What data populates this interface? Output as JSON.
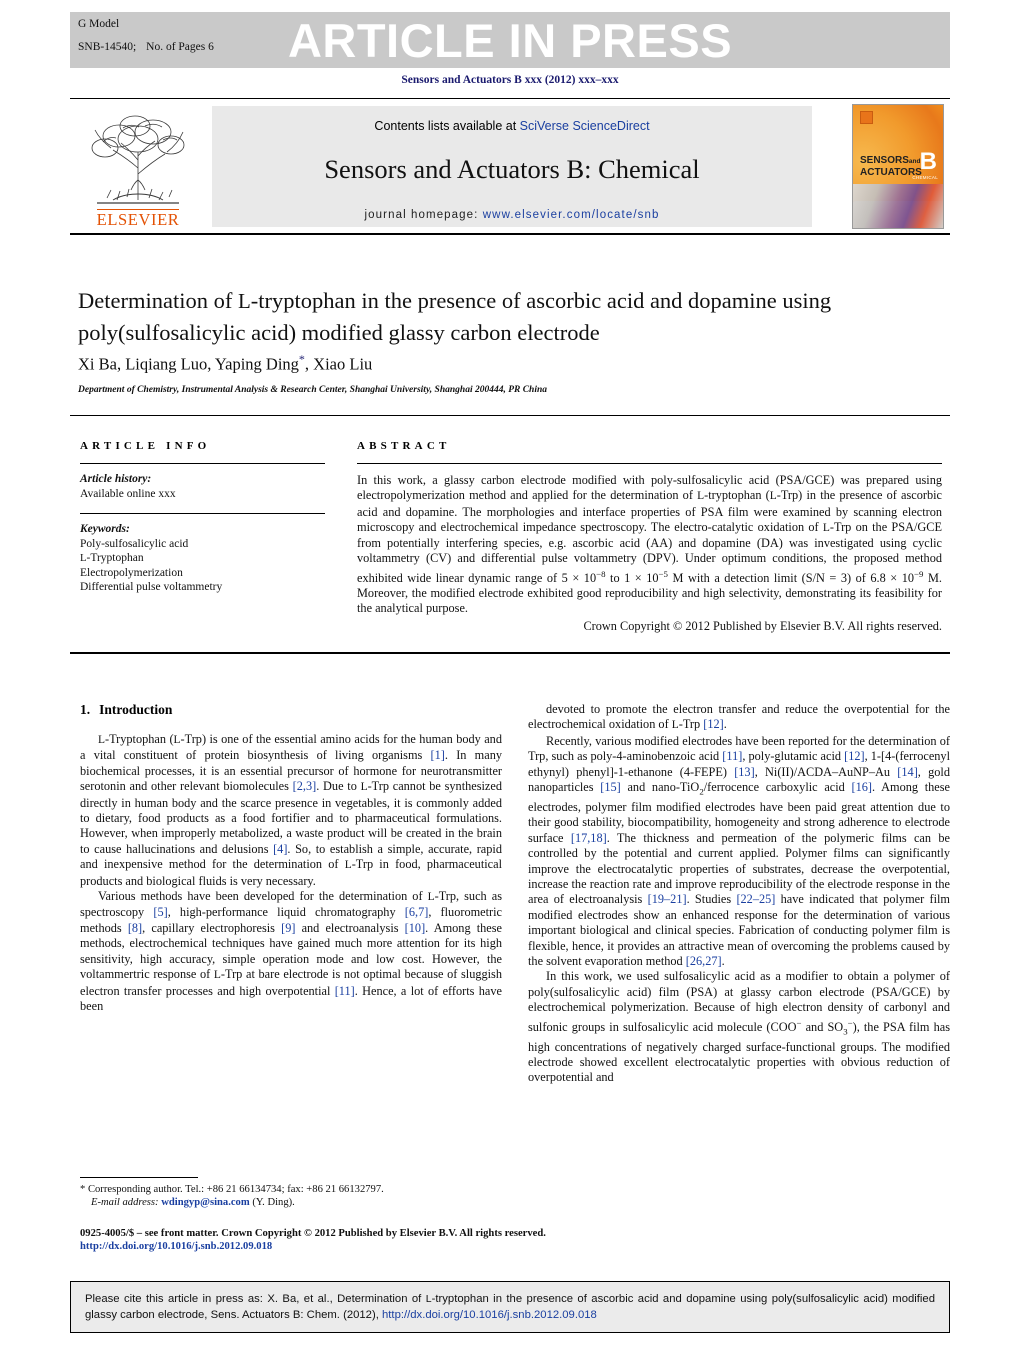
{
  "banner": {
    "press_text": "ARTICLE IN PRESS",
    "g_model": "G Model",
    "article_id": "SNB-14540;",
    "pages": "No. of Pages 6",
    "journal_ref": "Sensors and Actuators B xxx (2012) xxx–xxx"
  },
  "masthead": {
    "contents_prefix": "Contents lists available at ",
    "contents_link": "SciVerse ScienceDirect",
    "journal_title": "Sensors and Actuators B: Chemical",
    "homepage_label": "journal homepage:",
    "homepage_url": "www.elsevier.com/locate/snb",
    "publisher": "ELSEVIER",
    "cover_line1": "SENSORS",
    "cover_line1_sm": "and",
    "cover_line2": "ACTUATORS",
    "cover_letter": "B",
    "cover_sub": "CHEMICAL"
  },
  "article": {
    "title": "Determination of ʟ-tryptophan in the presence of ascorbic acid and dopamine using poly(sulfosalicylic acid) modified glassy carbon electrode",
    "authors": "Xi Ba, Liqiang Luo, Yaping Ding",
    "authors_tail": ", Xiao Liu",
    "affiliation": "Department of Chemistry, Instrumental Analysis & Research Center, Shanghai University, Shanghai 200444, PR China"
  },
  "info": {
    "heading": "ARTICLE INFO",
    "history_label": "Article history:",
    "history_value": "Available online xxx",
    "keywords_label": "Keywords:",
    "keywords": [
      "Poly-sulfosalicylic acid",
      "ʟ-Tryptophan",
      "Electropolymerization",
      "Differential pulse voltammetry"
    ]
  },
  "abstract": {
    "heading": "ABSTRACT",
    "body": "In this work, a glassy carbon electrode modified with poly-sulfosalicylic acid (PSA/GCE) was prepared using electropolymerization method and applied for the determination of ʟ-tryptophan (ʟ-Trp) in the presence of ascorbic acid and dopamine. The morphologies and interface properties of PSA film were examined by scanning electron microscopy and electrochemical impedance spectroscopy. The electro-catalytic oxidation of ʟ-Trp on the PSA/GCE from potentially interfering species, e.g. ascorbic acid (AA) and dopamine (DA) was investigated using cyclic voltammetry (CV) and differential pulse voltammetry (DPV). Under optimum conditions, the proposed method exhibited wide linear dynamic range of 5 × 10−8 to 1 × 10−5 M with a detection limit (S/N = 3) of 6.8 × 10−9 M. Moreover, the modified electrode exhibited good reproducibility and high selectivity, demonstrating its feasibility for the analytical purpose.",
    "copyright": "Crown Copyright © 2012 Published by Elsevier B.V. All rights reserved."
  },
  "intro": {
    "number": "1.",
    "heading": "Introduction",
    "left_paragraphs": [
      "ʟ-Tryptophan (ʟ-Trp) is one of the essential amino acids for the human body and a vital constituent of protein biosynthesis of living organisms [1]. In many biochemical processes, it is an essential precursor of hormone for neurotransmitter serotonin and other relevant biomolecules [2,3]. Due to ʟ-Trp cannot be synthesized directly in human body and the scarce presence in vegetables, it is commonly added to dietary, food products as a food fortifier and to pharmaceutical formulations. However, when improperly metabolized, a waste product will be created in the brain to cause hallucinations and delusions [4]. So, to establish a simple, accurate, rapid and inexpensive method for the determination of ʟ-Trp in food, pharmaceutical products and biological fluids is very necessary.",
      "Various methods have been developed for the determination of ʟ-Trp, such as spectroscopy [5], high-performance liquid chromatography [6,7], fluorometric methods [8], capillary electrophoresis [9] and electroanalysis [10]. Among these methods, electrochemical techniques have gained much more attention for its high sensitivity, high accuracy, simple operation mode and low cost. However, the voltammertric response of ʟ-Trp at bare electrode is not optimal because of sluggish electron transfer processes and high overpotential [11]. Hence, a lot of efforts have been"
    ],
    "right_paragraphs": [
      "devoted to promote the electron transfer and reduce the overpotential for the electrochemical oxidation of ʟ-Trp [12].",
      "Recently, various modified electrodes have been reported for the determination of Trp, such as poly-4-aminobenzoic acid [11], poly-glutamic acid [12], 1-[4-(ferrocenyl ethynyl) phenyl]-1-ethanone (4-FEPE) [13], Ni(II)/ACDA–AuNP–Au [14], gold nanoparticles [15] and nano-TiO2/ferrocence carboxylic acid [16]. Among these electrodes, polymer film modified electrodes have been paid great attention due to their good stability, biocompatibility, homogeneity and strong adherence to electrode surface [17,18]. The thickness and permeation of the polymeric films can be controlled by the potential and current applied. Polymer films can significantly improve the electrocatalytic properties of substrates, decrease the overpotential, increase the reaction rate and improve reproducibility of the electrode response in the area of electroanalysis [19–21]. Studies [22–25] have indicated that polymer film modified electrodes show an enhanced response for the determination of various important biological and clinical species. Fabrication of conducting polymer film is flexible, hence, it provides an attractive mean of overcoming the problems caused by the solvent evaporation method [26,27].",
      "In this work, we used sulfosalicylic acid as a modifier to obtain a polymer of poly(sulfosalicylic acid) film (PSA) at glassy carbon electrode (PSA/GCE) by electrochemical polymerization. Because of high electron density of carbonyl and sulfonic groups in sulfosalicylic acid molecule (COO− and SO3−), the PSA film has high concentrations of negatively charged surface-functional groups. The modified electrode showed excellent electrocatalytic properties with obvious reduction of overpotential and"
    ]
  },
  "footnote": {
    "corresponding": "* Corresponding author. Tel.: +86 21 66134734; fax: +86 21 66132797.",
    "email_label": "E-mail address:",
    "email": "wdingyp@sina.com",
    "email_tail": "(Y. Ding)."
  },
  "front_matter": {
    "line1": "0925-4005/$ – see front matter. Crown Copyright © 2012 Published by Elsevier B.V. All rights reserved.",
    "doi": "http://dx.doi.org/10.1016/j.snb.2012.09.018"
  },
  "citation": {
    "text_part1": "Please cite this article in press as: X. Ba, et al., Determination of ʟ-tryptophan in the presence of ascorbic acid and dopamine using poly(sulfosalicylic acid) modified glassy carbon electrode, Sens. Actuators B: Chem. (2012), ",
    "doi": "http://dx.doi.org/10.1016/j.snb.2012.09.018"
  },
  "colors": {
    "link": "#1a3fa0",
    "banner_bg": "#c9c9c9",
    "band_bg": "#e9e9e9",
    "elsevier_orange": "#E35205",
    "journal_ref": "#1a1a6e"
  }
}
